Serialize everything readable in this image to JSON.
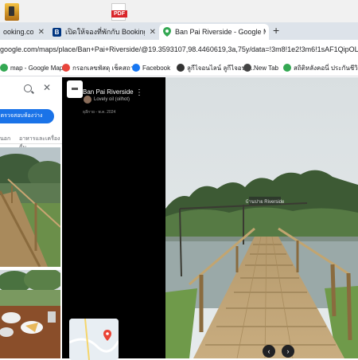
{
  "desktop": {
    "pdf_label": "PDF"
  },
  "tabs": [
    {
      "label": "ooking.com",
      "favicon": "B",
      "color": "#003580"
    },
    {
      "label": "เปิดให้จองที่พักกับ Booking.com",
      "favicon": "B",
      "color": "#003580"
    },
    {
      "label": "Ban Pai Riverside - Google Maps",
      "favicon": "maps-pin",
      "color": "#34a853"
    }
  ],
  "url": "google.com/maps/place/Ban+Pai+Riverside/@19.3593107,98.4460619,3a,75y/data=!3m8!1e2!3m6!1sAF1QipOL_FdW0tmeLqVS",
  "bookmarks": [
    {
      "label": "map - Google Maps",
      "color": "#34a853"
    },
    {
      "label": "กรอกเลขพัสดุ เช็คสถา...",
      "color": "#e8453c"
    },
    {
      "label": "Facebook",
      "color": "#1877f2"
    },
    {
      "label": "ลูกีไจอนไลน์ ลูกีไจอนไ...",
      "color": "#333333"
    },
    {
      "label": "New Tab",
      "color": "#444444"
    },
    {
      "label": "สถิติหลังคอนี่ ประกันชีวิตที่...",
      "color": "#34a853"
    }
  ],
  "left_panel": {
    "check_button": "ตรวจสอบห้องว่าง",
    "tab1": "นอก",
    "tab2": "อาหารและเครื่องดื่ม"
  },
  "photo_viewer": {
    "place_name": "Ban Pai Riverside",
    "author": "Lovely oil (oilhot)",
    "date": "ธุลีกาย - พ.ค. 2024",
    "sign_text": "บ้านปาย Riverside"
  },
  "colors": {
    "accent": "#1a73e8",
    "black_panel": "#000000"
  }
}
